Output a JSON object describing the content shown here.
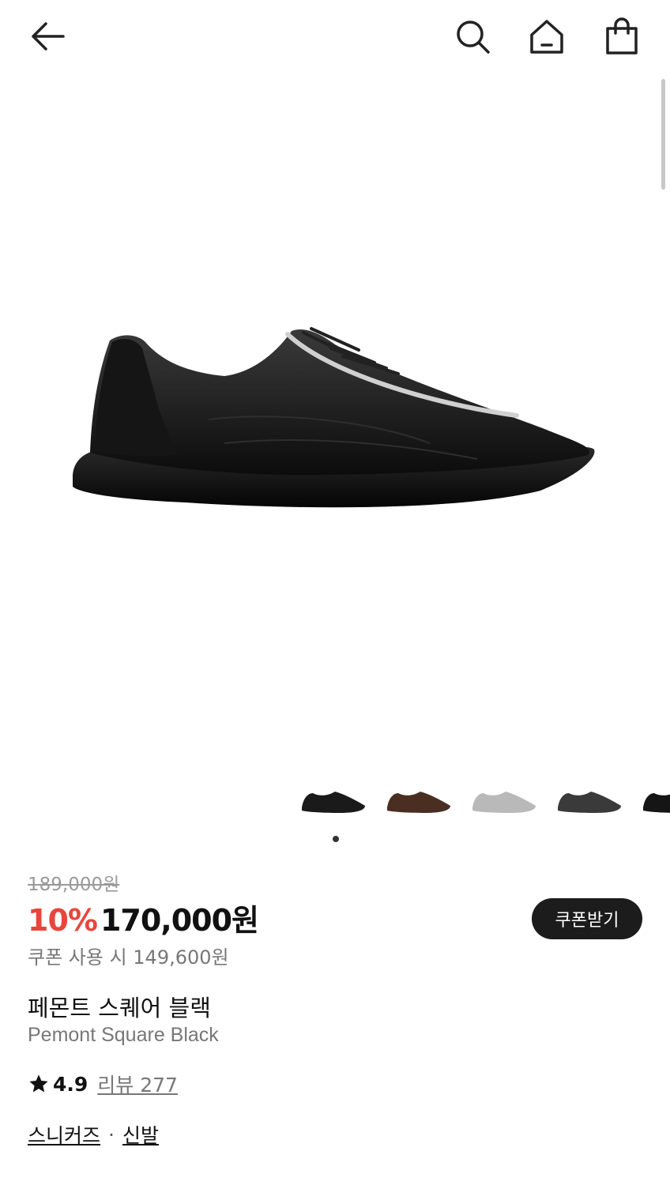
{
  "header": {
    "back_icon": "arrow-left-icon",
    "search_icon": "search-icon",
    "home_icon": "home-icon",
    "bag_icon": "shopping-bag-icon"
  },
  "gallery": {
    "thumbnails": [
      {
        "color": "#1a1a1a",
        "name": "black"
      },
      {
        "color": "#4a2e22",
        "name": "brown"
      },
      {
        "color": "#b9b9b9",
        "name": "silver"
      },
      {
        "color": "#3a3a3a",
        "name": "dark-grey"
      },
      {
        "color": "#151515",
        "name": "black-2"
      }
    ]
  },
  "product": {
    "original_price": "189,000원",
    "discount": "10%",
    "price": "170,000원",
    "coupon_price": "쿠폰 사용 시 149,600원",
    "coupon_button": "쿠폰받기",
    "name_ko": "페몬트 스퀘어 블랙",
    "name_en": "Pemont Square Black",
    "rating": "4.9",
    "review_label": "리뷰 277",
    "category_1": "스니커즈",
    "category_separator": "·",
    "category_2": "신발"
  },
  "colors": {
    "discount": "#e8453c",
    "button_bg": "#1c1c1c"
  }
}
